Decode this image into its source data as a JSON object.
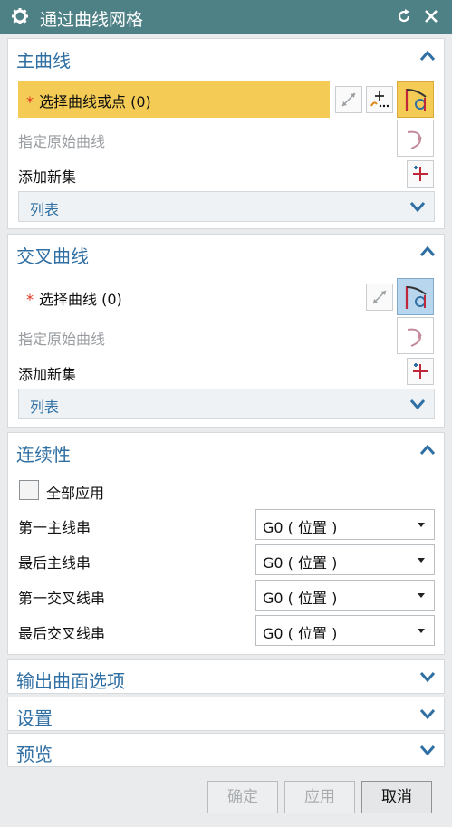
{
  "window": {
    "title": "通过曲线网格",
    "colors": {
      "titlebar": "#4e8186",
      "accent": "#2f6fa3",
      "highlight": "#f3cb55",
      "required": "#e0301e"
    }
  },
  "primary_curves": {
    "title": "主曲线",
    "select_label": "选择曲线或点 (0)",
    "required_mark": "*",
    "specify_original": "指定原始曲线",
    "add_new_set": "添加新集",
    "list_label": "列表"
  },
  "cross_curves": {
    "title": "交叉曲线",
    "select_label": "选择曲线 (0)",
    "required_mark": "*",
    "specify_original": "指定原始曲线",
    "add_new_set": "添加新集",
    "list_label": "列表"
  },
  "continuity": {
    "title": "连续性",
    "apply_all_label": "全部应用",
    "apply_all_checked": false,
    "rows": [
      {
        "label": "第一主线串",
        "value": "G0 ( 位置 )"
      },
      {
        "label": "最后主线串",
        "value": "G0 ( 位置 )"
      },
      {
        "label": "第一交叉线串",
        "value": "G0 ( 位置 )"
      },
      {
        "label": "最后交叉线串",
        "value": "G0 ( 位置 )"
      }
    ]
  },
  "collapsed_sections": {
    "output_surface": "输出曲面选项",
    "settings": "设置",
    "preview": "预览"
  },
  "footer": {
    "ok": "确定",
    "apply": "应用",
    "cancel": "取消"
  },
  "icons": {
    "title": "gear-icon",
    "reset": "reset-icon",
    "close": "close-icon",
    "collapse": "chevron-up-icon",
    "expand": "chevron-down-icon",
    "reverse": "reverse-direction-icon",
    "point_dialog": "point-dialog-icon",
    "curve_rule": "curve-rule-icon",
    "original_curve": "original-curve-icon",
    "add_set": "add-new-set-icon"
  }
}
